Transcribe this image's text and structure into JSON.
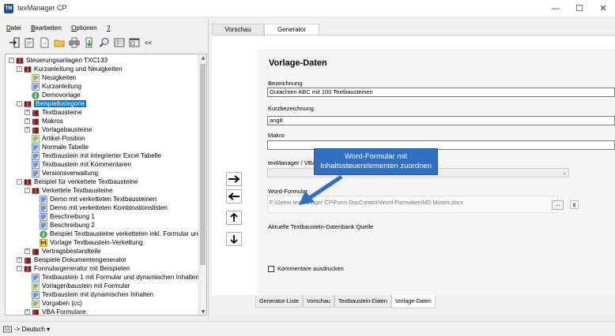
{
  "window": {
    "title": "texManager CP",
    "logo": "TM",
    "minimize": "—",
    "maximize": "☐",
    "close": "✕"
  },
  "menu": [
    {
      "first": "D",
      "rest": "atei"
    },
    {
      "first": "B",
      "rest": "earbeiten"
    },
    {
      "first": "O",
      "rest": "ptionen"
    },
    {
      "first": "?",
      "rest": ""
    }
  ],
  "toolbar": {
    "more_label": "<<"
  },
  "tree": [
    {
      "label": "Steuerungsanlagen TXC133",
      "level": 0,
      "exp": "-",
      "icon": "book-icon"
    },
    {
      "label": "Kurzanleitung und Neuigkeiten",
      "level": 1,
      "exp": "-",
      "icon": "book-icon"
    },
    {
      "label": "Neuigkeiten",
      "level": 2,
      "exp": "",
      "icon": "green-text-block-icon"
    },
    {
      "label": "Kurzanleitung",
      "level": 2,
      "exp": "",
      "icon": "blue-text-block-icon"
    },
    {
      "label": "Demovorlage",
      "level": 2,
      "exp": "",
      "icon": "info-green-icon"
    },
    {
      "label": "Beispielkategorie",
      "level": 1,
      "exp": "-",
      "icon": "book-icon",
      "selected": true
    },
    {
      "label": "Textbausteine",
      "level": 2,
      "exp": "+",
      "icon": "book-closed-icon"
    },
    {
      "label": "Makros",
      "level": 2,
      "exp": "+",
      "icon": "book-closed-icon"
    },
    {
      "label": "Vorlagebausteine",
      "level": 2,
      "exp": "+",
      "icon": "book-closed-icon"
    },
    {
      "label": "Artikel-Position",
      "level": 2,
      "exp": "",
      "icon": "green-text-block-icon"
    },
    {
      "label": "Normale Tabelle",
      "level": 2,
      "exp": "",
      "icon": "blue-text-block-icon"
    },
    {
      "label": "Textbaustein mit integrierter Excel Tabelle",
      "level": 2,
      "exp": "",
      "icon": "blue-text-block-icon"
    },
    {
      "label": "Textbaustein mit Kommentaren",
      "level": 2,
      "exp": "",
      "icon": "blue-text-block-icon"
    },
    {
      "label": "Versionsverwaltung",
      "level": 2,
      "exp": "",
      "icon": "blue-text-block-icon"
    },
    {
      "label": "Beispiel für verkettete Textbausteine",
      "level": 1,
      "exp": "-",
      "icon": "book-icon"
    },
    {
      "label": "Verkettete Textbausteine",
      "level": 2,
      "exp": "-",
      "icon": "book-icon"
    },
    {
      "label": "Demo mit verketteten Textbausteinen",
      "level": 3,
      "exp": "",
      "icon": "blue-text-block-icon"
    },
    {
      "label": "Demo mit verketteten Kombinationslisten",
      "level": 3,
      "exp": "",
      "icon": "blue-text-block-icon"
    },
    {
      "label": "Beschreibung 1",
      "level": 3,
      "exp": "",
      "icon": "blue-text-block-icon"
    },
    {
      "label": "Beschreibung 2",
      "level": 3,
      "exp": "",
      "icon": "blue-text-block-icon"
    },
    {
      "label": "Beispiel Textbausteine verketteten inkl. Formular und",
      "level": 3,
      "exp": "",
      "icon": "info-green-icon"
    },
    {
      "label": "Vorlage Textbaustein-Verkettung",
      "level": 3,
      "exp": "",
      "icon": "yellow-m-icon"
    },
    {
      "label": "Vertragsbestandteile",
      "level": 2,
      "exp": "+",
      "icon": "book-closed-icon"
    },
    {
      "label": "Beispiele Dokumentengenerator",
      "level": 1,
      "exp": "+",
      "icon": "book-closed-icon"
    },
    {
      "label": "Formulargenerator mit Beispielen",
      "level": 1,
      "exp": "-",
      "icon": "book-icon"
    },
    {
      "label": "Textbaustein 1 mit Formular und dynamischen Inhalten",
      "level": 2,
      "exp": "",
      "icon": "blue-text-block-icon"
    },
    {
      "label": "Vorlagenbaustein mit Formular",
      "level": 2,
      "exp": "",
      "icon": "green-text-block-icon"
    },
    {
      "label": "Textbaustein mit  dynamischen Inhalten",
      "level": 2,
      "exp": "",
      "icon": "blue-text-block-icon"
    },
    {
      "label": "Vorgaben (cc)",
      "level": 2,
      "exp": "",
      "icon": "green-text-block-icon"
    },
    {
      "label": "VBA Formulare",
      "level": 2,
      "exp": "+",
      "icon": "book-closed-icon"
    }
  ],
  "tabs_top": [
    {
      "label": "Vorschau",
      "active": false
    },
    {
      "label": "Generator",
      "active": true
    }
  ],
  "form": {
    "title": "Vorlage-Daten",
    "bezeichnung_label": "Bezeichnung",
    "bezeichnung_value": "Gutachten ABC mit 100 Textbausteinen",
    "kurz_label": "Kurzbezeichnung",
    "kurz_value": "ang8",
    "makro_label": "Makro",
    "makro_value": "",
    "vba_label": "texManager / VBA Fo",
    "word_label": "Word-Formular",
    "word_path": "F:\\Demo texManager CP\\Form DocCreator\\Word-Formulare\\MD Muster.docx",
    "quelle_label": "Aktuelle Textbaustein-Datenbank Quelle",
    "kommentare_label": "Kommentare ausdrucken",
    "browse_label": "...",
    "clear_label": "x"
  },
  "callout": {
    "line1": "Word-Formular mit",
    "line2": "Inhaltssteuerelementen zuordnen"
  },
  "tabs_bottom": [
    {
      "label": "Generator-Liste",
      "active": false
    },
    {
      "label": "Vorschau",
      "active": false
    },
    {
      "label": "Textbaustein-Daten",
      "active": false
    },
    {
      "label": "Vorlage-Daten",
      "active": true
    }
  ],
  "statusbar": {
    "language": "-> Deutsch ▾"
  },
  "colors": {
    "accent": "#0078d7",
    "callout": "#2f6fc4",
    "book": "#8a1e1e"
  }
}
